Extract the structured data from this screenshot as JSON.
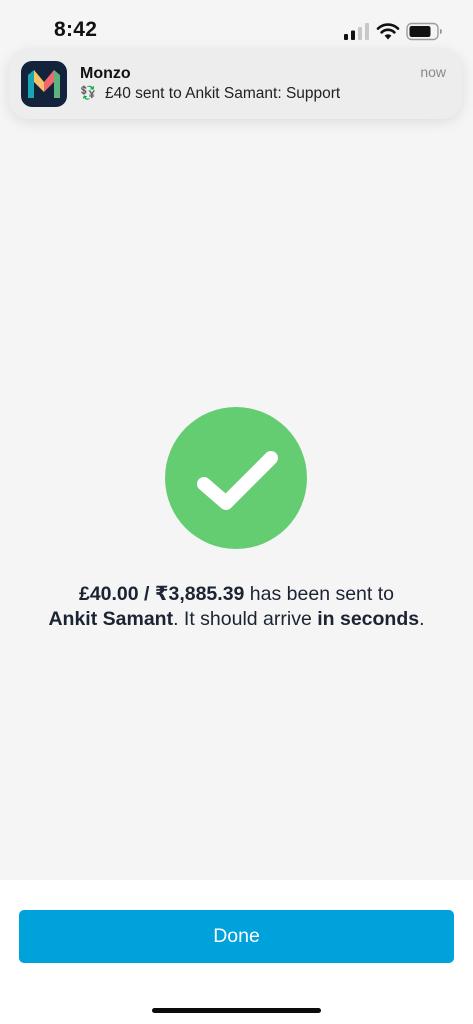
{
  "status_bar": {
    "time": "8:42",
    "icons": [
      "signal-icon",
      "wifi-icon",
      "battery-icon"
    ]
  },
  "notification": {
    "app_name": "Monzo",
    "time": "now",
    "emoji": "💱",
    "message": "£40 sent to Ankit Samant: Support",
    "icon": "monzo-logo-icon"
  },
  "success": {
    "icon": "checkmark-icon",
    "color": "#64cd72",
    "amount_gbp": "£40.00",
    "separator": " / ",
    "amount_inr": "₹3,885.39",
    "text_sent_to": " has been sent to",
    "recipient": "Ankit Samant",
    "text_arrive": ". It should arrive ",
    "arrival": "in seconds",
    "end": "."
  },
  "actions": {
    "done_label": "Done",
    "done_color": "#00a2dc"
  }
}
